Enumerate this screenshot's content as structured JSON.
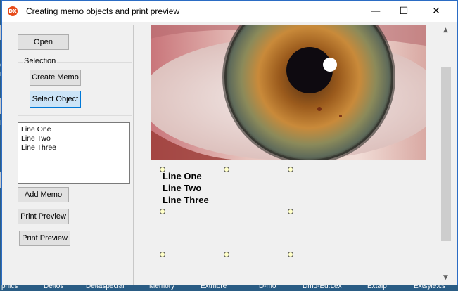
{
  "desktop": {
    "left_labels": [
      "Of",
      "m",
      "Re"
    ],
    "taskbar_items": [
      "phics",
      "Deltos",
      "Deltaspecial",
      "Memory",
      "Extmore",
      "D-mo",
      "Dmo-Ed.Lex",
      "Extalp",
      "Extsyle.cs"
    ]
  },
  "window": {
    "title": "Creating memo objects and print preview",
    "app_icon_text": "DX",
    "minimize_glyph": "—",
    "maximize_glyph": "☐",
    "close_glyph": "✕"
  },
  "left_panel": {
    "open_label": "Open",
    "selection_title": "Selection",
    "create_memo_label": "Create Memo",
    "select_object_label": "Select Object",
    "memo_lines": [
      "Line One",
      "Line Two",
      "Line Three"
    ],
    "add_memo_label": "Add Memo",
    "print_preview_1_label": "Print Preview",
    "print_preview_2_label": "Print Preview"
  },
  "canvas": {
    "image_icon": "eye-photo",
    "memo_lines": [
      "Line One",
      "Line Two",
      "Line Three"
    ]
  },
  "scrollbar": {
    "up_glyph": "▲",
    "down_glyph": "▼"
  },
  "colors": {
    "title_border": "#2b6cc4",
    "focus_accent": "#0078d7",
    "handle_fill": "#ffffc8"
  }
}
